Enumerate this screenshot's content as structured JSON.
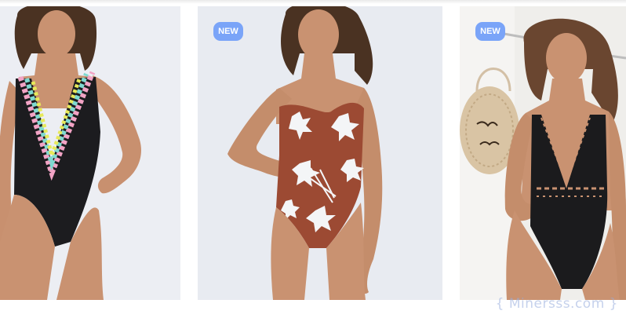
{
  "products": [
    {
      "id": "card-1",
      "badge": ""
    },
    {
      "id": "card-2",
      "badge": "NEW"
    },
    {
      "id": "card-3",
      "badge": "NEW"
    }
  ],
  "watermark": "{ Minersss.com }",
  "colors": {
    "card_bg_left": "#eceef3",
    "card_bg_middle": "#e8ebf1",
    "card_bg_right": "#efeeeb",
    "badge": "#7aa4f8",
    "skin": "#c99271",
    "hair": "#4a3222"
  }
}
